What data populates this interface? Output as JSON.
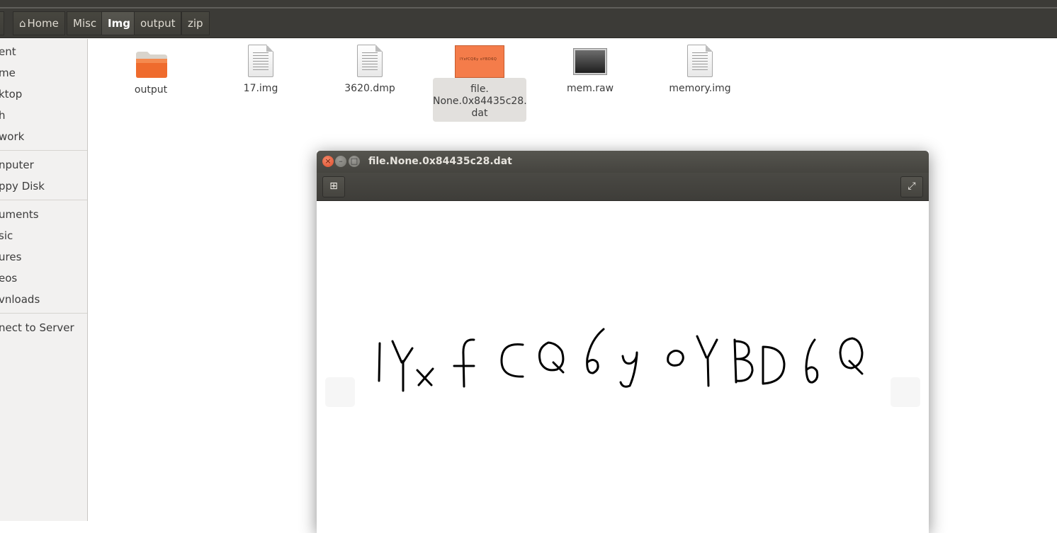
{
  "breadcrumb": {
    "items": [
      {
        "label": "Home"
      },
      {
        "label": "Misc"
      },
      {
        "label": "Img"
      },
      {
        "label": "output"
      },
      {
        "label": "zip"
      }
    ]
  },
  "sidebar": {
    "items": [
      {
        "label": "ent"
      },
      {
        "label": "me"
      },
      {
        "label": "ktop"
      },
      {
        "label": "h"
      },
      {
        "label": "work"
      },
      {
        "label": "nputer"
      },
      {
        "label": "ppy Disk"
      },
      {
        "label": "uments"
      },
      {
        "label": "sic"
      },
      {
        "label": "ures"
      },
      {
        "label": "eos"
      },
      {
        "label": "vnloads"
      },
      {
        "label": "nect to Server"
      }
    ]
  },
  "files": [
    {
      "name": "output",
      "icon": "folder-icon"
    },
    {
      "name": "17.img",
      "icon": "document-icon"
    },
    {
      "name": "3620.dmp",
      "icon": "document-icon"
    },
    {
      "name": "file.\nNone.0x84435c28.\ndat",
      "icon": "image-thumbnail",
      "selected": true
    },
    {
      "name": "mem.raw",
      "icon": "monitor-icon"
    },
    {
      "name": "memory.img",
      "icon": "document-icon"
    }
  ],
  "viewer": {
    "title": "file.None.0x84435c28.dat",
    "image_text": "lYxfCQ6yoYBD6Q"
  },
  "colors": {
    "titlebar": "#3c3b37",
    "accent_orange": "#f47c4a",
    "close_button": "#dd4b2b"
  }
}
